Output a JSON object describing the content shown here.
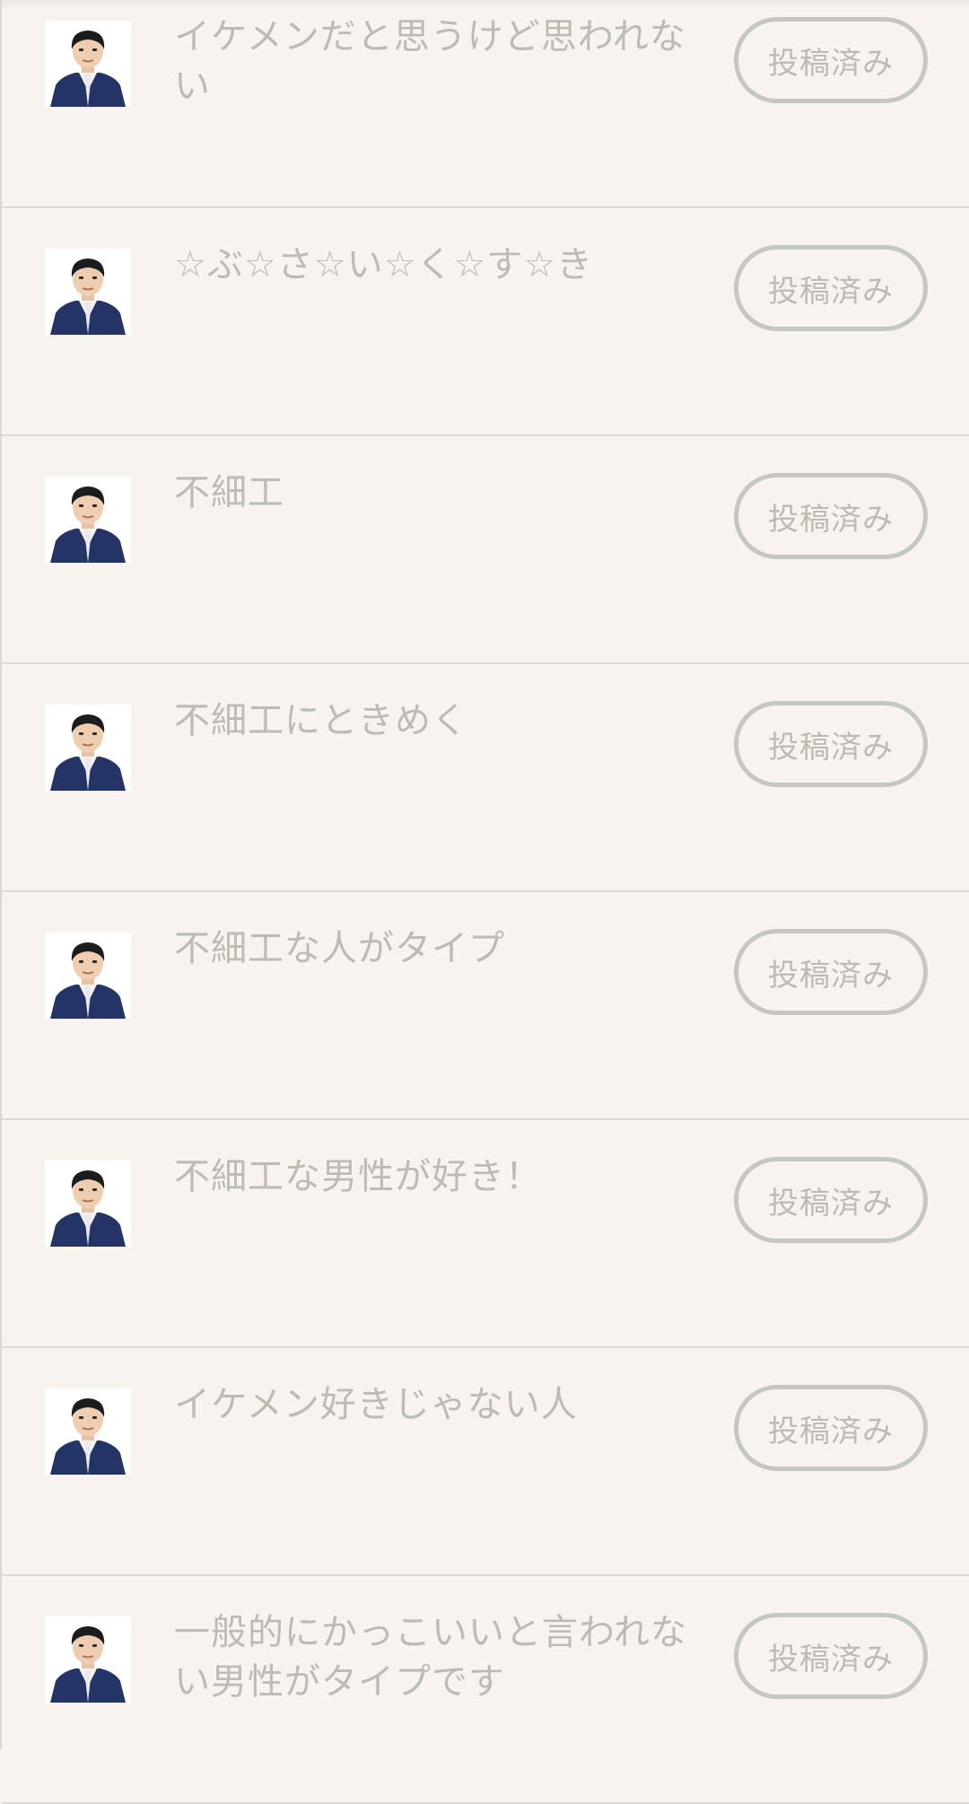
{
  "posted_label": "投稿済み",
  "items": [
    {
      "text": "イケメンだと思うけど思われない"
    },
    {
      "text": "☆ぶ☆さ☆い☆く☆す☆き"
    },
    {
      "text": "不細工"
    },
    {
      "text": "不細工にときめく"
    },
    {
      "text": "不細工な人がタイプ"
    },
    {
      "text": "不細工な男性が好き！"
    },
    {
      "text": "イケメン好きじゃない人"
    },
    {
      "text": "一般的にかっこいいと言われない男性がタイプです"
    }
  ],
  "colors": {
    "background": "#f8f3ef",
    "text_muted": "#bcbcb4",
    "button_border": "#c4c8c0",
    "divider": "#dddad6"
  }
}
